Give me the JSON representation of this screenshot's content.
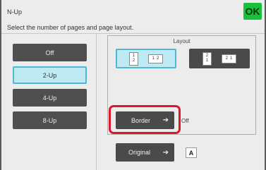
{
  "header": {
    "title": "N-Up",
    "subtitle": "Select the number of pages and page layout.",
    "ok_label": "OK"
  },
  "nup_options": [
    {
      "label": "Off",
      "selected": false
    },
    {
      "label": "2-Up",
      "selected": true
    },
    {
      "label": "4-Up",
      "selected": false
    },
    {
      "label": "8-Up",
      "selected": false
    }
  ],
  "layout": {
    "label": "Layout",
    "option1": {
      "tall_top": "1",
      "tall_bottom": "2",
      "wide_left": "1",
      "wide_right": "2"
    },
    "option2": {
      "tall_top": "2",
      "tall_bottom": "1",
      "wide_left": "2",
      "wide_right": "1"
    }
  },
  "border": {
    "label": "Border",
    "arrow": "➔",
    "value": "Off"
  },
  "original": {
    "label": "Original",
    "arrow": "➔",
    "orientation": "A"
  },
  "colors": {
    "accent": "#4fb8d2",
    "ok": "#19c03a",
    "highlight": "#e0162b"
  }
}
